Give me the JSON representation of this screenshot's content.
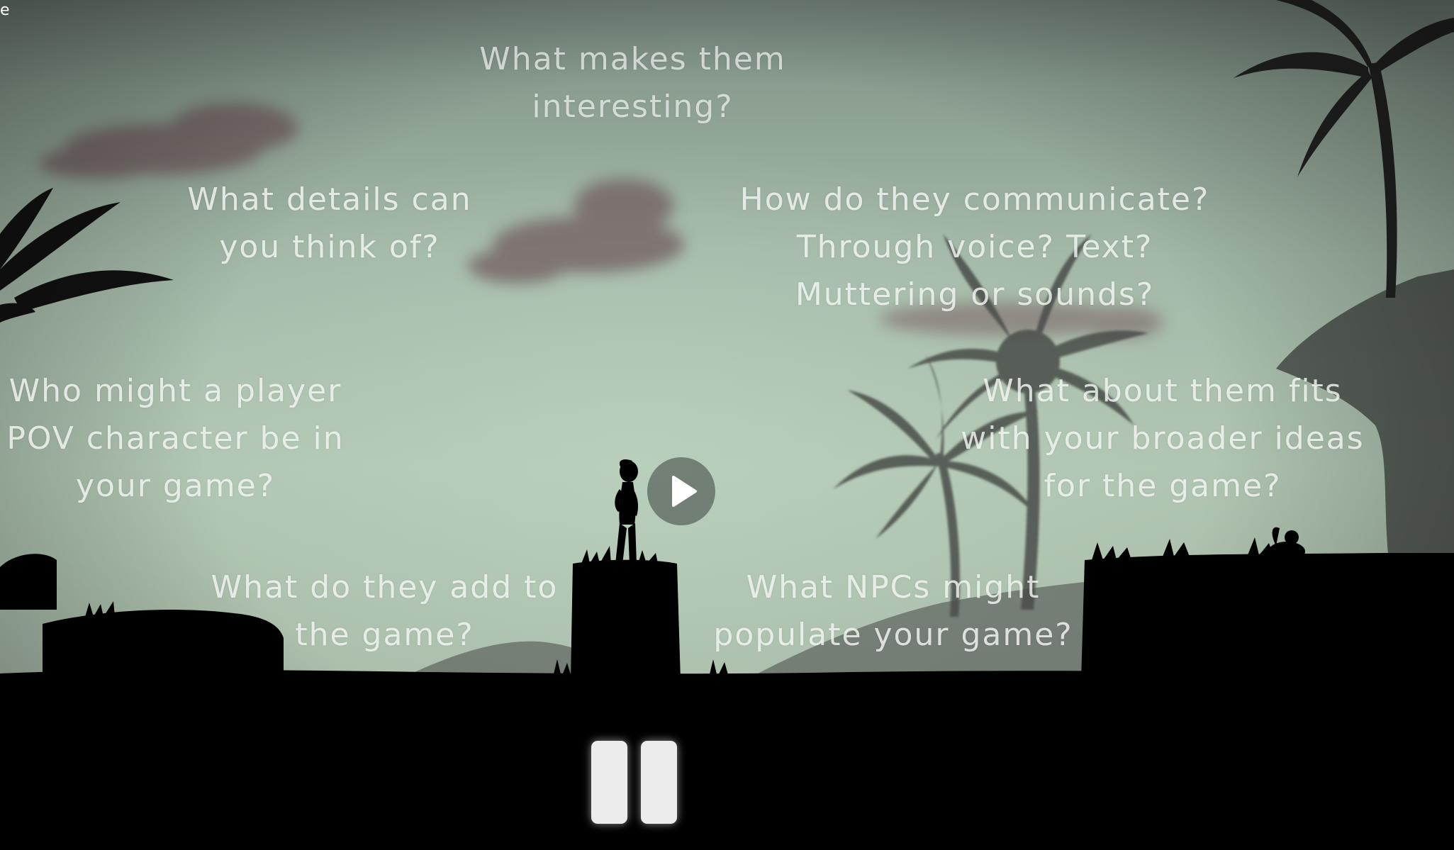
{
  "corner_label": "e",
  "prompts": {
    "interesting": "What makes them\ninteresting?",
    "details": "What details can\nyou think of?",
    "communicate": "How do they communicate?\nThrough voice? Text?\nMuttering or sounds?",
    "pov": "Who might a player\nPOV character be in\nyour game?",
    "fits": "What about them fits\nwith your broader ideas\nfor the game?",
    "add": "What do they add to\nthe game?",
    "npcs": "What NPCs might\npopulate your game?"
  },
  "controls": {
    "play": "play-icon",
    "pause": "pause-icon"
  },
  "colors": {
    "sky": "#b1c6b2",
    "silhouette": "#000000",
    "cloud": "#6e5a5c",
    "text": "#f5f8f4"
  }
}
